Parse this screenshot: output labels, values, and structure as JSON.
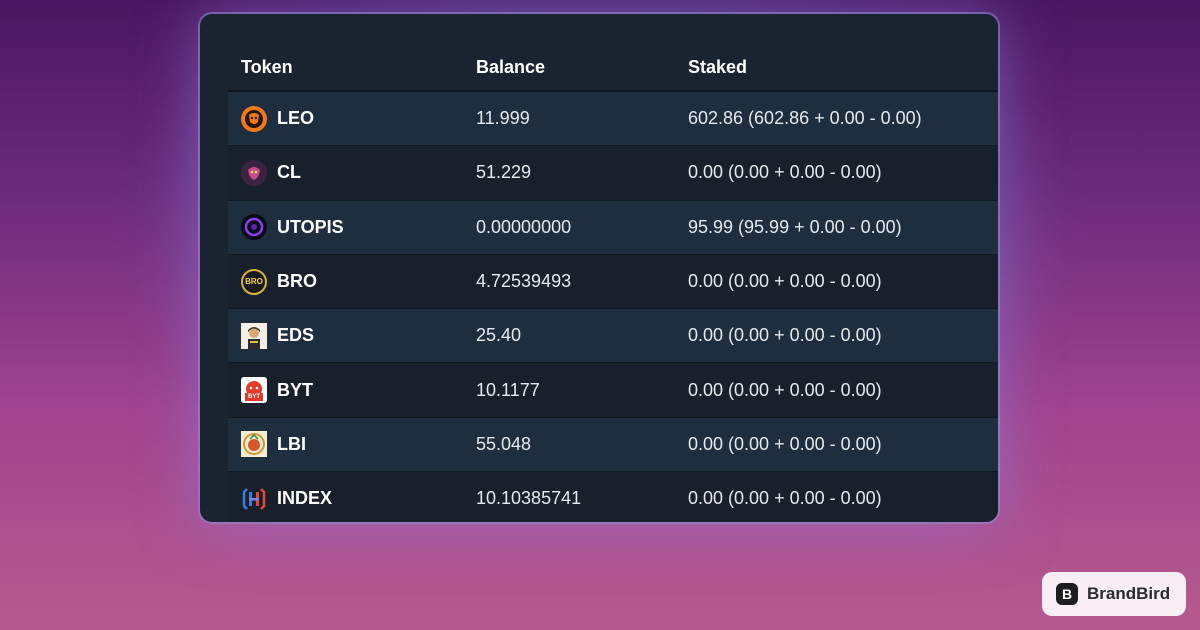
{
  "table": {
    "headers": {
      "token": "Token",
      "balance": "Balance",
      "staked": "Staked"
    },
    "rows": [
      {
        "token": "LEO",
        "icon": "leo-token-icon",
        "balance": "11.999",
        "staked": "602.86 (602.86 + 0.00 - 0.00)"
      },
      {
        "token": "CL",
        "icon": "cl-token-icon",
        "balance": "51.229",
        "staked": "0.00 (0.00 + 0.00 - 0.00)"
      },
      {
        "token": "UTOPIS",
        "icon": "utopis-token-icon",
        "balance": "0.00000000",
        "staked": "95.99 (95.99 + 0.00 - 0.00)"
      },
      {
        "token": "BRO",
        "icon": "bro-token-icon",
        "balance": "4.72539493",
        "staked": "0.00 (0.00 + 0.00 - 0.00)"
      },
      {
        "token": "EDS",
        "icon": "eds-token-icon",
        "balance": "25.40",
        "staked": "0.00 (0.00 + 0.00 - 0.00)"
      },
      {
        "token": "BYT",
        "icon": "byt-token-icon",
        "balance": "10.1177",
        "staked": "0.00 (0.00 + 0.00 - 0.00)"
      },
      {
        "token": "LBI",
        "icon": "lbi-token-icon",
        "balance": "55.048",
        "staked": "0.00 (0.00 + 0.00 - 0.00)"
      },
      {
        "token": "INDEX",
        "icon": "index-token-icon",
        "balance": "10.10385741",
        "staked": "0.00 (0.00 + 0.00 - 0.00)"
      }
    ]
  },
  "icons": {
    "bro_text": "BRO",
    "byt_text": "BYT"
  },
  "watermark": {
    "text": "BrandBird",
    "logo_glyph": "B"
  },
  "colors": {
    "card_bg": "#1a2430",
    "row_odd": "#1f2e3e",
    "row_even": "#18212b",
    "text": "#e6e9ee"
  }
}
